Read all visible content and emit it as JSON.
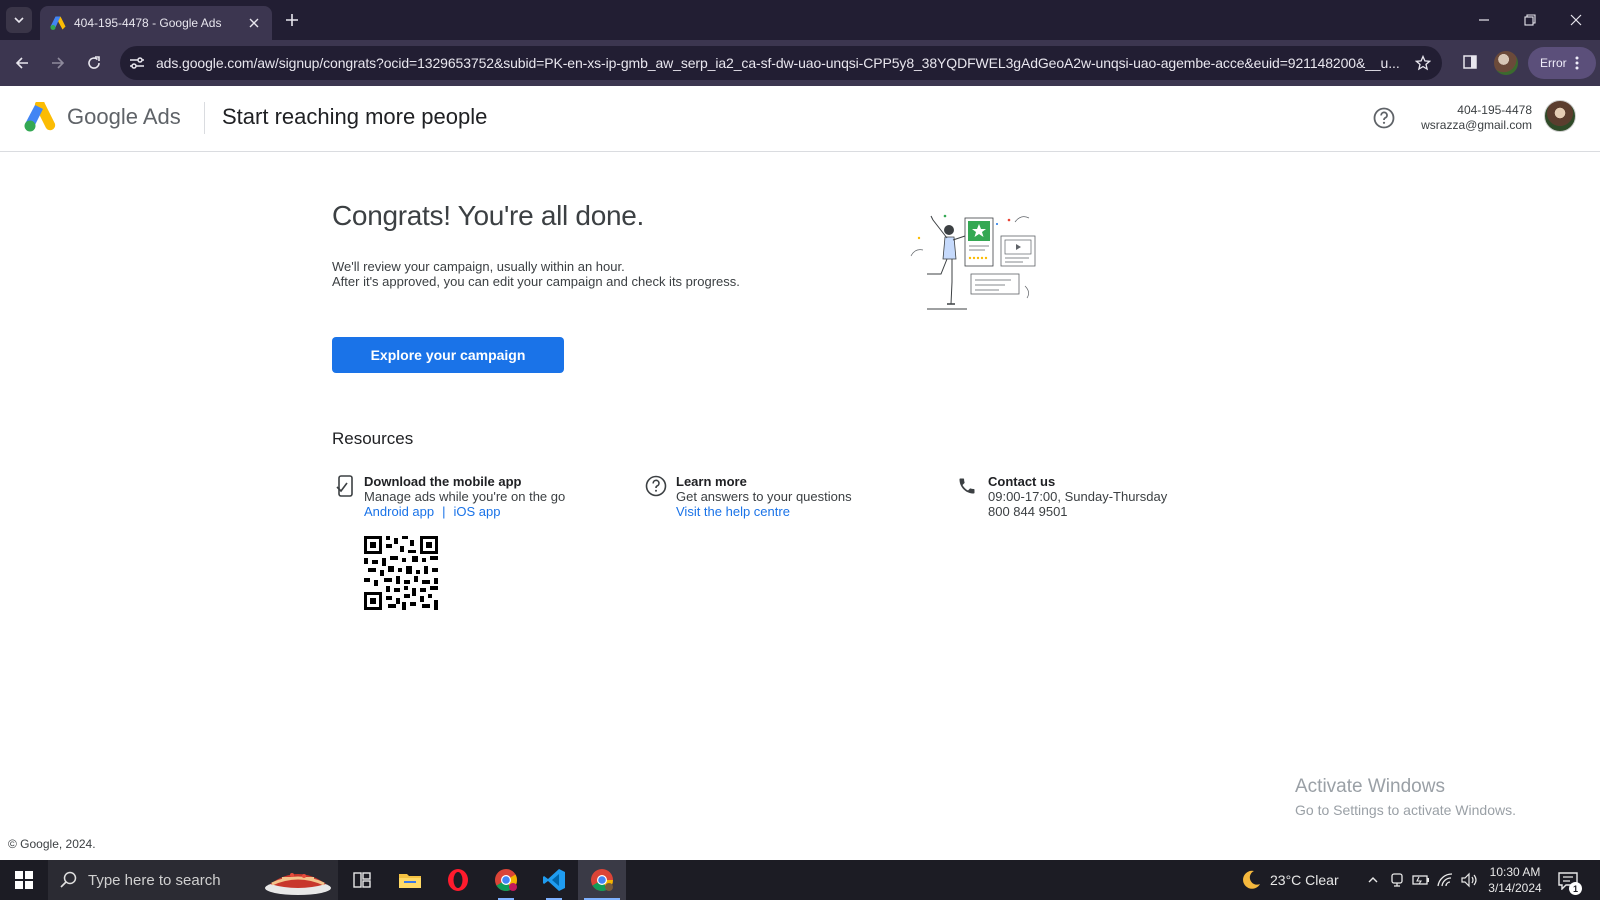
{
  "browser": {
    "tab_title": "404-195-4478 - Google Ads",
    "url": "ads.google.com/aw/signup/congrats?ocid=1329653752&subid=PK-en-xs-ip-gmb_aw_serp_ia2_ca-sf-dw-uao-unqsi-CPP5y8_38YQDFWEL3gAdGeoA2w-unqsi-uao-agembe-acce&euid=921148200&__u...",
    "profile_status": "Error"
  },
  "header": {
    "brand_google": "Google",
    "brand_ads": "Ads",
    "title": "Start reaching more people",
    "account_id": "404-195-4478",
    "account_email": "wsrazza@gmail.com"
  },
  "main": {
    "congrats_title": "Congrats! You're all done.",
    "desc_line1": "We'll review your campaign, usually within an hour.",
    "desc_line2": "After it's approved, you can edit your campaign and check its progress.",
    "explore_button": "Explore your campaign"
  },
  "resources": {
    "title": "Resources",
    "mobile": {
      "title": "Download the mobile app",
      "subtitle": "Manage ads while you're on the go",
      "android_link": "Android app",
      "separator": "|",
      "ios_link": "iOS app"
    },
    "learn": {
      "title": "Learn more",
      "subtitle": "Get answers to your questions",
      "link": "Visit the help centre"
    },
    "contact": {
      "title": "Contact us",
      "hours": "09:00-17:00, Sunday-Thursday",
      "phone": "800 844 9501"
    }
  },
  "watermark": {
    "line1": "Activate Windows",
    "line2": "Go to Settings to activate Windows."
  },
  "footer": {
    "copyright": "© Google, 2024."
  },
  "taskbar": {
    "search_placeholder": "Type here to search",
    "weather": "23°C  Clear",
    "time": "10:30 AM",
    "date": "3/14/2024",
    "notification_count": "1",
    "apps": [
      "task-view-icon",
      "file-explorer-icon",
      "opera-icon",
      "chrome-icon",
      "vscode-icon",
      "chrome-icon"
    ]
  },
  "colors": {
    "accent": "#1a73e8",
    "chrome_dark": "#221e33",
    "chrome_toolbar": "#3c3650",
    "taskbar": "#1c1c24"
  }
}
